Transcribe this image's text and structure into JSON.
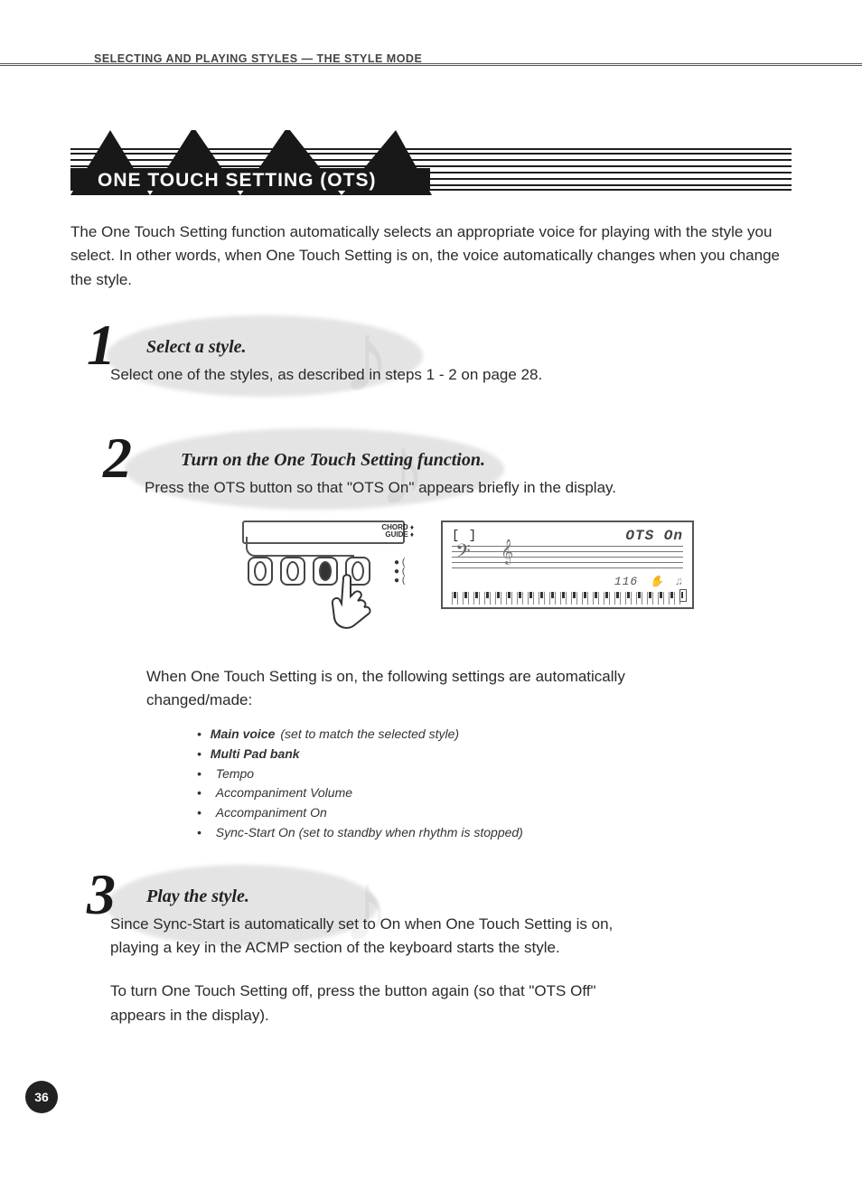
{
  "header": {
    "breadcrumb": "SELECTING AND PLAYING STYLES — THE STYLE MODE"
  },
  "section": {
    "title": "ONE TOUCH SETTING (OTS)",
    "intro": "The One Touch Setting function automatically selects an appropriate voice for playing with the style you select.  In other words, when One Touch Setting is on, the voice automatically changes when you change the style."
  },
  "steps": [
    {
      "number": "1",
      "title": "Select a style.",
      "body": "Select one of the styles, as described in steps 1 - 2 on page 28."
    },
    {
      "number": "2",
      "title": "Turn on the One Touch Setting function.",
      "body": "Press the OTS button so that \"OTS On\" appears briefly in the display."
    },
    {
      "number": "3",
      "title": "Play the style.",
      "body": "Since Sync-Start is automatically set to On when One Touch Setting is on, playing a key in the ACMP section of the keyboard starts the style.",
      "body2": "To turn One Touch Setting off, press the button again (so that \"OTS Off\" appears in the display)."
    }
  ],
  "panel_label_line1": "CHORD",
  "panel_label_line2": "GUIDE",
  "lcd": {
    "status_text": "OTS On",
    "tempo_value": "116",
    "left_bracket": "[   ]"
  },
  "after_illus_text": "When One Touch Setting is on, the following settings are automatically changed/made:",
  "bullets": [
    {
      "strong": "Main voice",
      "rest": " (set to match the selected style)"
    },
    {
      "strong": "Multi Pad bank",
      "rest": ""
    },
    {
      "strong": "",
      "rest": "Tempo"
    },
    {
      "strong": "",
      "rest": "Accompaniment Volume"
    },
    {
      "strong": "",
      "rest": "Accompaniment On"
    },
    {
      "strong": "",
      "rest": "Sync-Start On (set to standby when rhythm is stopped)"
    }
  ],
  "page_number": "36"
}
